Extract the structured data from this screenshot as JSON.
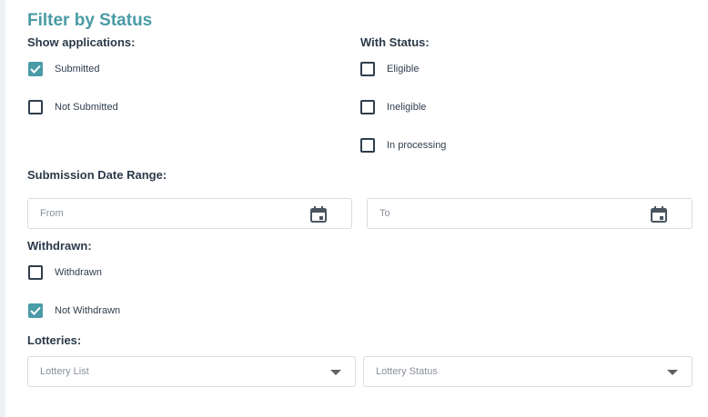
{
  "title": "Filter by Status",
  "colors": {
    "accent": "#4a9ba6",
    "text": "#2b3a4a",
    "border": "#d9dde0",
    "placeholder": "#8a9199"
  },
  "show_applications": {
    "label": "Show applications:",
    "options": [
      {
        "label": "Submitted",
        "checked": true
      },
      {
        "label": "Not Submitted",
        "checked": false
      }
    ]
  },
  "with_status": {
    "label": "With Status:",
    "options": [
      {
        "label": "Eligible",
        "checked": false
      },
      {
        "label": "Ineligible",
        "checked": false
      },
      {
        "label": "In processing",
        "checked": false
      }
    ]
  },
  "date_range": {
    "label": "Submission Date Range:",
    "from_placeholder": "From",
    "to_placeholder": "To",
    "icon": "calendar-icon"
  },
  "withdrawn": {
    "label": "Withdrawn:",
    "options": [
      {
        "label": "Withdrawn",
        "checked": false
      },
      {
        "label": "Not Withdrawn",
        "checked": true
      }
    ]
  },
  "lotteries": {
    "label": "Lotteries:",
    "list_placeholder": "Lottery List",
    "status_placeholder": "Lottery Status",
    "icon": "chevron-down-icon"
  }
}
